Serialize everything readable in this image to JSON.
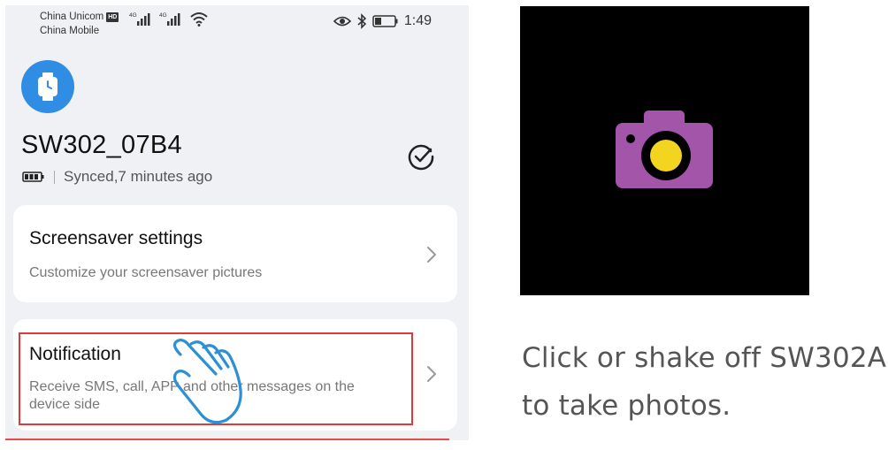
{
  "statusbar": {
    "carrier_1": "China Unicom",
    "carrier_1_badge": "HD",
    "carrier_2": "China Mobile",
    "time": "1:49",
    "icons": [
      "signal-4g-icon",
      "signal-4g-icon",
      "wifi-icon",
      "eye-icon",
      "bluetooth-icon",
      "battery-icon"
    ]
  },
  "device": {
    "icon": "watch-icon",
    "name": "SW302_07B4",
    "sync_status": "Synced,7 minutes ago",
    "status_icons": [
      "battery-icon",
      "check-circle-icon"
    ]
  },
  "settings": [
    {
      "title": "Screensaver settings",
      "subtitle": "Customize your screensaver pictures"
    },
    {
      "title": "Notification",
      "subtitle": "Receive SMS, call, APP and other messages on the device side",
      "highlighted": true
    }
  ],
  "camera_panel": {
    "icon": "camera-icon",
    "colors": {
      "background": "#000000",
      "camera_body": "#a255a9",
      "lens": "#f3d51f"
    }
  },
  "caption": {
    "line_1": "Click or shake off SW302A",
    "line_2": "to take photos."
  },
  "colors": {
    "accent": "#2f8de4",
    "highlight": "#dd3b3b",
    "hand_outline": "#2d8fd4"
  }
}
